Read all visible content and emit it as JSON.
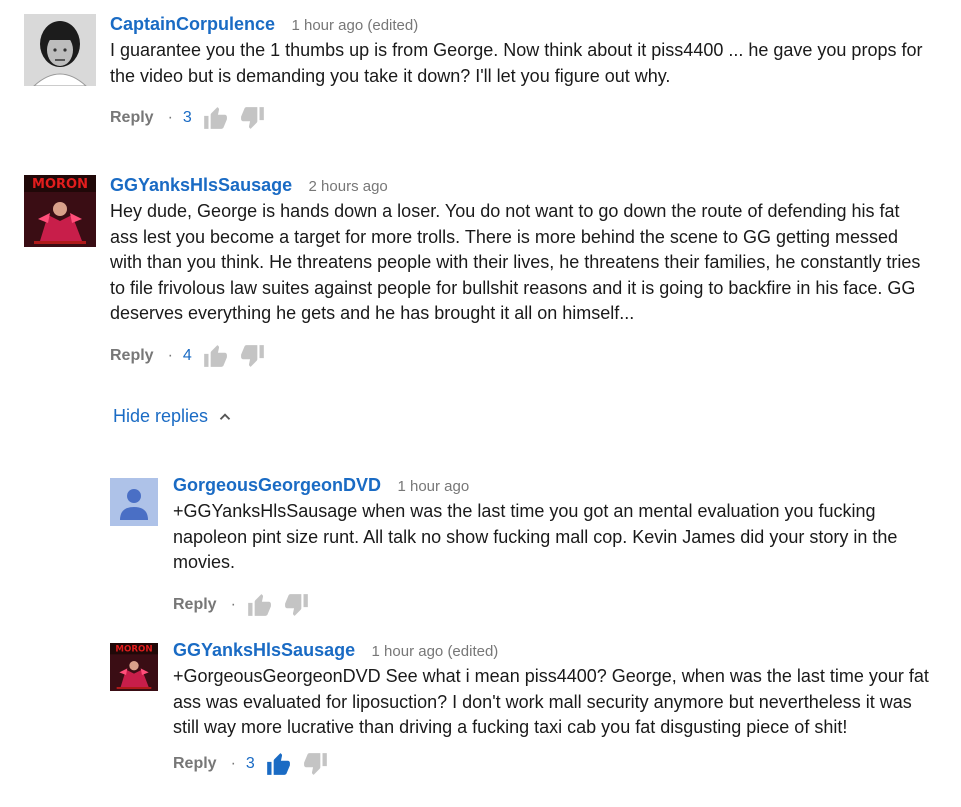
{
  "comments": [
    {
      "author": "CaptainCorpulence",
      "time": "1 hour ago (edited)",
      "text": "I guarantee you the 1 thumbs up is from George. Now think about it piss4400 ... he gave you props for the video but is demanding you take it down? I'll let you figure out why.",
      "reply_label": "Reply",
      "dot": "·",
      "likes": "3"
    },
    {
      "author": "GGYanksHlsSausage",
      "time": "2 hours ago",
      "text": "Hey dude, George is hands down a loser.  You do not want to go down the route of defending his fat ass lest you become a target for more trolls.  There is more behind the scene to GG getting messed with than you think.  He threatens people with their lives, he threatens their families,  he constantly tries to file frivolous law suites against people for bullshit reasons and it is going to backfire in his face.  GG deserves everything he gets and he has brought it all on himself...",
      "reply_label": "Reply",
      "dot": "·",
      "likes": "4",
      "avatar_text": "MORON"
    }
  ],
  "hide_replies_label": "Hide replies",
  "replies": [
    {
      "author": "GorgeousGeorgeonDVD",
      "time": "1 hour ago",
      "text": "+GGYanksHlsSausage when was the last time you got an mental evaluation you fucking napoleon pint size runt.  All talk no show fucking mall cop. Kevin James did your story in the movies.",
      "reply_label": "Reply",
      "dot": "·"
    },
    {
      "author": "GGYanksHlsSausage",
      "time": "1 hour ago (edited)",
      "text": "+GorgeousGeorgeonDVD See what i mean piss4400?  George, when was the last time your fat ass was evaluated for liposuction?  I don't work mall security anymore but nevertheless it was still way more lucrative than driving a fucking taxi cab you fat disgusting piece of shit!",
      "reply_label": "Reply",
      "dot": "·",
      "likes": "3",
      "avatar_text": "MORON"
    }
  ],
  "colors": {
    "link": "#1a6bc4",
    "muted": "#777777",
    "thumb_inactive": "#c4c4c4",
    "thumb_active": "#1a6bc4"
  }
}
